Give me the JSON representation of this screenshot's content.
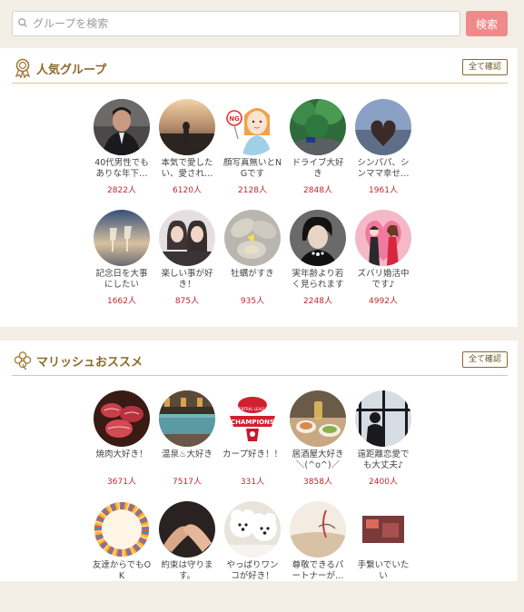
{
  "search": {
    "placeholder": "グループを検索",
    "button_label": "検索"
  },
  "popular": {
    "title": "人気グループ",
    "see_all": "全て確認",
    "items": [
      {
        "name": "40代男性でもありな年下…",
        "count": "2822人"
      },
      {
        "name": "本気で愛したい、愛され…",
        "count": "6120人"
      },
      {
        "name": "顔写真無いとNGです",
        "count": "2128人"
      },
      {
        "name": "ドライブ大好き",
        "count": "2848人"
      },
      {
        "name": "シンパパ、シンママ幸せ…",
        "count": "1961人"
      },
      {
        "name": "記念日を大事にしたい",
        "count": "1662人"
      },
      {
        "name": "楽しい事が好き！",
        "count": "875人"
      },
      {
        "name": "牡蠣がすき",
        "count": "935人"
      },
      {
        "name": "実年齢より若く見られます",
        "count": "2248人"
      },
      {
        "name": "ズバリ婚活中です♪",
        "count": "4992人"
      }
    ]
  },
  "recommend": {
    "title": "マリッシュおススメ",
    "see_all": "全て確認",
    "items": [
      {
        "name": "焼肉大好き！",
        "count": "3671人"
      },
      {
        "name": "温泉♨大好き",
        "count": "7517人"
      },
      {
        "name": "カープ好き！！",
        "count": "331人"
      },
      {
        "name": "居酒屋大好き＼(^o^)／",
        "count": "3858人"
      },
      {
        "name": "遠距離恋愛でも大丈夫♪",
        "count": "2400人"
      },
      {
        "name": "友達からでもOK",
        "count": ""
      },
      {
        "name": "約束は守ります。",
        "count": ""
      },
      {
        "name": "やっぱりワンコが好き！",
        "count": ""
      },
      {
        "name": "尊敬できるパートナーが…",
        "count": ""
      },
      {
        "name": "手繋いでいたい",
        "count": ""
      }
    ]
  },
  "icons": {
    "search": "search-icon",
    "popular": "medal-icon",
    "recommend": "clover-icon"
  },
  "colors": {
    "accent": "#8a6a2a",
    "search_button": "#f08a8a",
    "count": "#c0282d",
    "background": "#f3eee6"
  }
}
